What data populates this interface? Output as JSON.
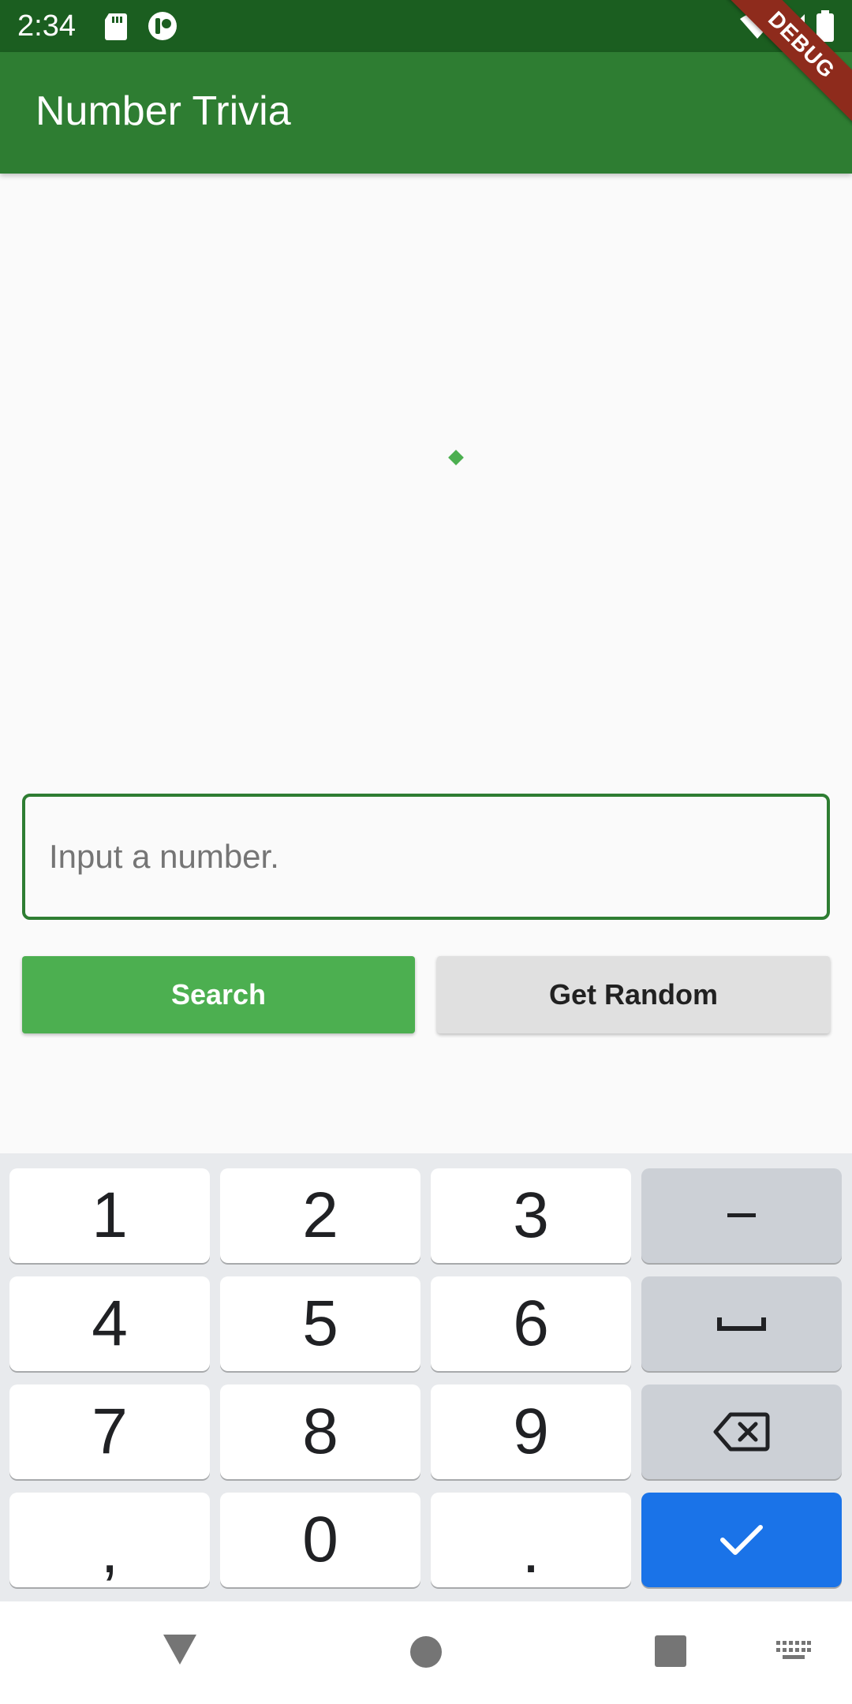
{
  "status_bar": {
    "time": "2:34",
    "icons": [
      "sd-card-icon",
      "app-notification-icon",
      "wifi-icon",
      "signal-icon",
      "battery-icon"
    ]
  },
  "debug_banner": {
    "label": "DEBUG"
  },
  "app_bar": {
    "title": "Number Trivia"
  },
  "input": {
    "placeholder": "Input a number.",
    "value": ""
  },
  "buttons": {
    "search": "Search",
    "random": "Get Random"
  },
  "keyboard": {
    "keys": [
      "1",
      "2",
      "3",
      "−",
      "4",
      "5",
      "6",
      "␣",
      "7",
      "8",
      "9",
      "⌫",
      ",",
      "0",
      ".",
      "✓"
    ]
  },
  "nav_bar": {
    "icons": [
      "back-icon",
      "home-icon",
      "recents-icon",
      "keyboard-switch-icon"
    ]
  },
  "colors": {
    "status_bar": "#1b5e20",
    "app_bar": "#2e7d32",
    "primary_button": "#4caf50",
    "secondary_button": "#e0e0e0",
    "keyboard_done": "#1a73e8",
    "keyboard_bg": "#e8eaed"
  }
}
